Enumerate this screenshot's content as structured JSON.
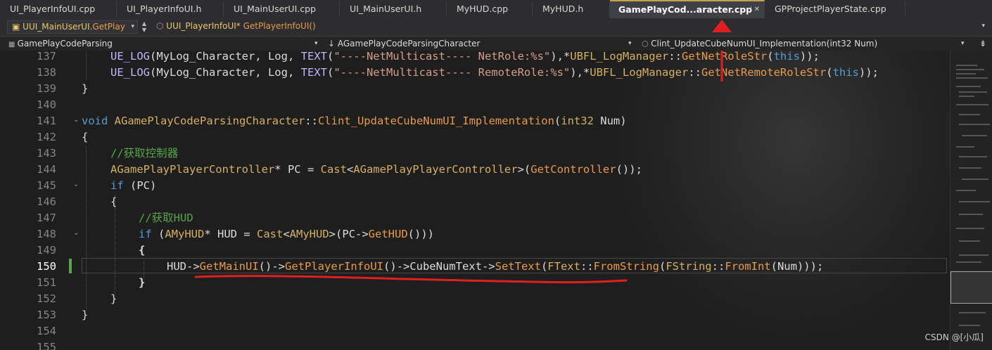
{
  "tabs": [
    {
      "label": "UI_PlayerInfoUI.cpp"
    },
    {
      "label": "UI_PlayerInfoUI.h"
    },
    {
      "label": "UI_MainUserUI.cpp"
    },
    {
      "label": "UI_MainUserUI.h"
    },
    {
      "label": "MyHUD.cpp"
    },
    {
      "label": "MyHUD.h"
    },
    {
      "label": "GamePlayCod...aracter.cpp",
      "icons": "⊣ ✕"
    },
    {
      "label": "GPProjectPlayerState.cpp"
    }
  ],
  "toolbar": {
    "scope_class": "UUI_MainUserUI.",
    "scope_member": "GetPlay",
    "member_class": "UUI_PlayerInfoUI*",
    "member_func": "GetPlayerInfoUI()"
  },
  "nav": {
    "project": "GamePlayCodeParsing",
    "class": "AGamePlayCodeParsingCharacter",
    "member": "Clint_UpdateCubeNumUI_Implementation(int32 Num)",
    "split_icon": "⇟"
  },
  "line_numbers": [
    "137",
    "138",
    "139",
    "140",
    "141",
    "142",
    "143",
    "144",
    "145",
    "146",
    "147",
    "148",
    "149",
    "150",
    "151",
    "152",
    "153",
    "154",
    "155"
  ],
  "current_line": "150",
  "code": {
    "l137": {
      "macro": "UE_LOG",
      "p1": "(MyLog_Character, Log, ",
      "text_macro": "TEXT",
      "p2": "(",
      "str": "\"----NetMulticast---- NetRole:%s\"",
      "p3": "),*",
      "cls": "UBFL_LogManager",
      "sep": "::",
      "fn": "GetNetRoleStr",
      "p4": "(",
      "kw": "this",
      "p5": "));"
    },
    "l138": {
      "macro": "UE_LOG",
      "p1": "(MyLog_Character, Log, ",
      "text_macro": "TEXT",
      "p2": "(",
      "str": "\"----NetMulticast---- RemoteRole:%s\"",
      "p3": "),*",
      "cls": "UBFL_LogManager",
      "sep": "::",
      "fn": "GetNetRemoteRoleStr",
      "p4": "(",
      "kw": "this",
      "p5": "));"
    },
    "l139": "}",
    "l141": {
      "kw": "void",
      "cls": "AGamePlayCodeParsingCharacter",
      "sep": "::",
      "fn": "Clint_UpdateCubeNumUI_Implementation",
      "p1": "(",
      "type": "int32",
      "param": " Num",
      "p2": ")"
    },
    "l142": "{",
    "l143": "//获取控制器",
    "l144": {
      "cls": "AGamePlayPlayerController",
      "p1": "* PC = ",
      "fn": "Cast",
      "lt": "<",
      "cls2": "AGamePlayPlayerController",
      "gt": ">(",
      "fn2": "GetController",
      "p2": "());"
    },
    "l145": {
      "kw": "if",
      "p1": " (PC)"
    },
    "l146": "{",
    "l147": "//获取HUD",
    "l148": {
      "kw": "if",
      "p1": " (",
      "cls": "AMyHUD",
      "p2": "* HUD = ",
      "fn": "Cast",
      "lt": "<",
      "cls2": "AMyHUD",
      "p3": ">(PC->",
      "fn2": "GetHUD",
      "p4": "()))"
    },
    "l149": "{",
    "l150": {
      "p1": "HUD->",
      "fn1": "GetMainUI",
      "p2": "()->",
      "fn2": "GetPlayerInfoUI",
      "p3": "()->CubeNumText->",
      "fn3": "SetText",
      "p4": "(",
      "cls": "FText",
      "sep1": "::",
      "fn4": "FromString",
      "p5": "(",
      "cls2": "FString",
      "sep2": "::",
      "fn5": "FromInt",
      "p6": "(Num)));"
    },
    "l151": "}",
    "l152": "}",
    "l153": "}"
  },
  "watermark": "CSDN @[小瓜]",
  "colors": {
    "annotation_red": "#e02020",
    "keyword": "#569cd6",
    "class": "#d5b063",
    "comment": "#57a64a",
    "string": "#d69d85"
  }
}
